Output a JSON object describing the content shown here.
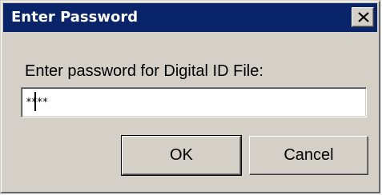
{
  "window": {
    "title": "Enter Password",
    "close_icon": "close-icon"
  },
  "form": {
    "prompt": "Enter password for Digital ID File:",
    "password_value": "****"
  },
  "buttons": {
    "ok_label": "OK",
    "cancel_label": "Cancel"
  },
  "colors": {
    "titlebar": "#0a246a",
    "dialog_face": "#d4d0c8"
  }
}
